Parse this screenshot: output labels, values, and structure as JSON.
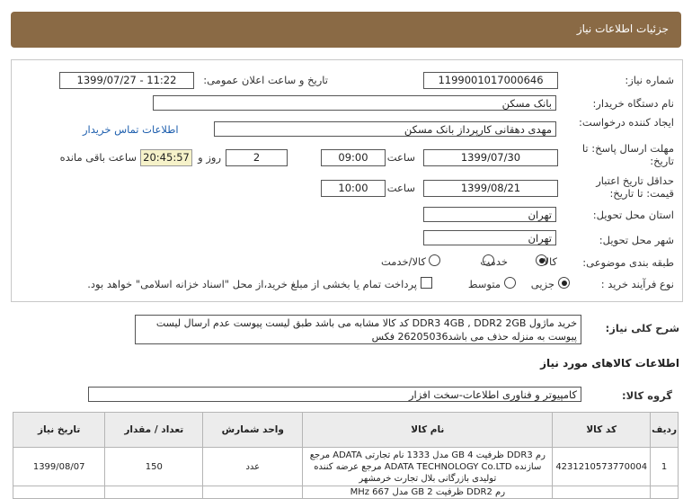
{
  "header": {
    "title": "جزئیات اطلاعات نیاز"
  },
  "form": {
    "need_number_label": "شماره نیاز:",
    "need_number": "1199001017000646",
    "announce_label": "تاریخ و ساعت اعلان عمومی:",
    "announce_value": "1399/07/27 - 11:22",
    "buyer_label": "نام دستگاه خریدار:",
    "buyer_value": "بانک مسکن",
    "creator_label": "ایجاد کننده درخواست:",
    "creator_value": "مهدی دهقانی کارپرداز بانک مسکن",
    "contact_link": "اطلاعات تماس خریدار",
    "deadline_label": "مهلت ارسال پاسخ: تا تاریخ:",
    "deadline_date": "1399/07/30",
    "time_label": "ساعت",
    "deadline_time": "09:00",
    "days_value": "2",
    "days_label": "روز و",
    "remaining_value": "20:45:57",
    "remaining_label": "ساعت باقی مانده",
    "validity_label": "حداقل تاریخ اعتبار قیمت: تا تاریخ:",
    "validity_date": "1399/08/21",
    "validity_time": "10:00",
    "province_label": "استان محل تحویل:",
    "province_value": "تهران",
    "city_label": "شهر محل تحویل:",
    "city_value": "تهران",
    "category_label": "طبقه بندی موضوعی:",
    "category_options": [
      "کالا",
      "خدمت",
      "کالا/خدمت"
    ],
    "process_label": "نوع فرآیند خرید :",
    "process_options": [
      "جزیی",
      "متوسط"
    ],
    "payment_note": "پرداخت تمام یا بخشی از مبلغ خرید،از محل \"اسناد خزانه اسلامی\" خواهد بود."
  },
  "description": {
    "label": "شرح کلی نیاز:",
    "text": "خرید ماژول DDR3 4GB , DDR2 2GB  کد کالا مشابه می باشد طبق لیست پیوست عدم ارسال لیست پیوست به منزله حذف می باشد26205036 فکس"
  },
  "goods": {
    "section_title": "اطلاعات کالاهای مورد نیاز",
    "group_label": "گروه کالا:",
    "group_value": "کامپیوتر و فناوری اطلاعات-سخت افزار",
    "columns": [
      "ردیف",
      "کد کالا",
      "نام کالا",
      "واحد شمارش",
      "تعداد / مقدار",
      "تاریخ نیاز"
    ],
    "rows": [
      {
        "index": "1",
        "code": "4231210573770004",
        "name": "رم DDR3 ظرفیت 4 GB مدل 1333 نام تجارتی ADATA مرجع سازنده ADATA TECHNOLOGY Co.LTD مرجع عرضه کننده تولیدی بازرگانی بلال تجارت خرمشهر",
        "unit": "عدد",
        "qty": "150",
        "date": "1399/08/07"
      },
      {
        "index": "",
        "code": "",
        "name": "رم DDR2 ظرفیت 2 GB مدل 667 MHz",
        "unit": "",
        "qty": "",
        "date": ""
      }
    ]
  }
}
